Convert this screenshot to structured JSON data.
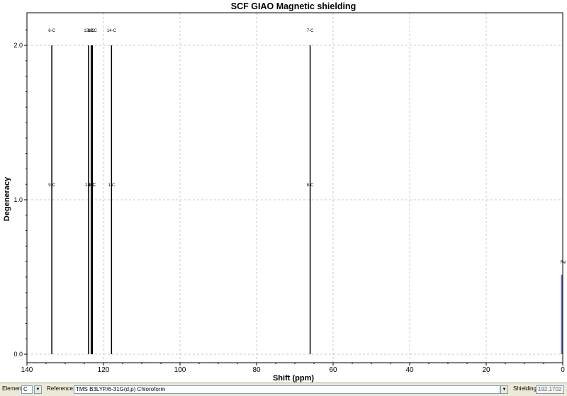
{
  "chart_data": {
    "type": "stick",
    "title": "SCF GIAO Magnetic shielding",
    "xlabel": "Shift (ppm)",
    "ylabel": "Degeneracy",
    "xlim": [
      140,
      0
    ],
    "ylim": [
      0,
      2.2
    ],
    "x_ticks": [
      140,
      120,
      100,
      80,
      60,
      40,
      20,
      0
    ],
    "y_ticks": [
      0.0,
      1.0,
      2.0
    ],
    "x_tick_labels": [
      "140",
      "120",
      "100",
      "80",
      "60",
      "40",
      "20",
      "0"
    ],
    "y_tick_labels": [
      "0.0",
      "1.0",
      "2.0"
    ],
    "grid": true,
    "peaks": [
      {
        "shift": 133.5,
        "degeneracy": 2,
        "labels": [
          "9-C",
          "6-C"
        ]
      },
      {
        "shift": 123.9,
        "degeneracy": 2,
        "labels": [
          "2-C",
          "13-C"
        ]
      },
      {
        "shift": 123.2,
        "degeneracy": 2,
        "labels": [
          "4-C",
          "3-C"
        ]
      },
      {
        "shift": 122.9,
        "degeneracy": 2,
        "labels": [
          "5-C",
          "12-C"
        ]
      },
      {
        "shift": 117.9,
        "degeneracy": 2,
        "labels": [
          "1-C",
          "14-C"
        ]
      },
      {
        "shift": 66.0,
        "degeneracy": 2,
        "labels": [
          "8-C",
          "7-C"
        ]
      }
    ],
    "reference_peak": {
      "shift": 0.0,
      "degeneracy": 0.5,
      "label": "Re",
      "color": "#6b6bb5"
    },
    "colors": {
      "stick": "#000000",
      "grid": "#c8c8c8",
      "axis": "#000000"
    }
  },
  "controls": {
    "element_label": "Element:",
    "element_value": "C",
    "reference_label": "Reference:",
    "reference_value": "TMS B3LYP/6-31G(d,p) Chloroform",
    "shielding_label": "Shielding:",
    "shielding_value": "192.1702",
    "dropdown_glyph": "▼"
  }
}
